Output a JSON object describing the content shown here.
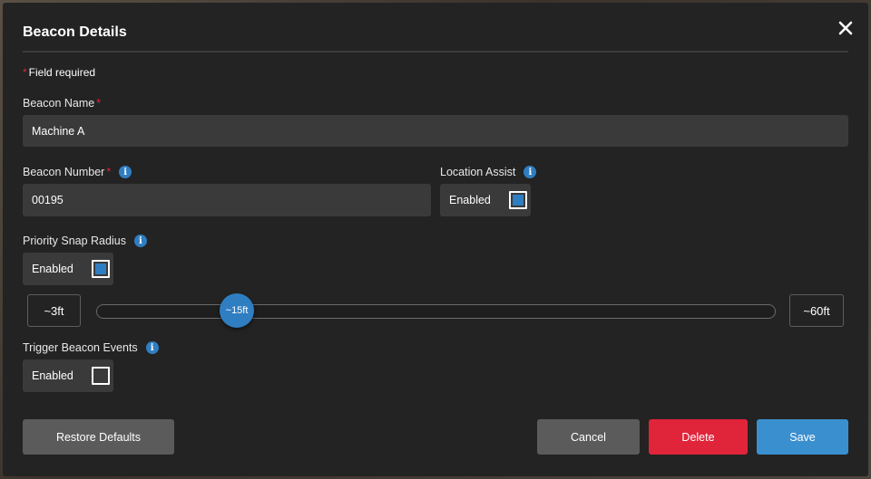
{
  "modal": {
    "title": "Beacon Details",
    "required_note": "Field required",
    "required_marker": "*"
  },
  "beacon_name": {
    "label": "Beacon Name",
    "value": "Machine A"
  },
  "beacon_number": {
    "label": "Beacon Number",
    "value": "00195",
    "info_icon": "i"
  },
  "location_assist": {
    "label": "Location Assist",
    "toggle_label": "Enabled",
    "checked": true,
    "info_icon": "i"
  },
  "priority_snap_radius": {
    "label": "Priority Snap Radius",
    "toggle_label": "Enabled",
    "checked": true,
    "info_icon": "i",
    "slider": {
      "min_label": "~3ft",
      "max_label": "~60ft",
      "value_label": "~15ft",
      "fraction": 0.207
    }
  },
  "trigger_beacon_events": {
    "label": "Trigger Beacon Events",
    "toggle_label": "Enabled",
    "checked": false,
    "info_icon": "i"
  },
  "buttons": {
    "restore": "Restore Defaults",
    "cancel": "Cancel",
    "delete": "Delete",
    "save": "Save"
  },
  "colors": {
    "accent": "#2f7ec2",
    "danger": "#e0243a",
    "save": "#3a8fcf",
    "modal_bg": "#232323"
  },
  "icons": {
    "close": "close-icon",
    "info": "info-icon"
  }
}
